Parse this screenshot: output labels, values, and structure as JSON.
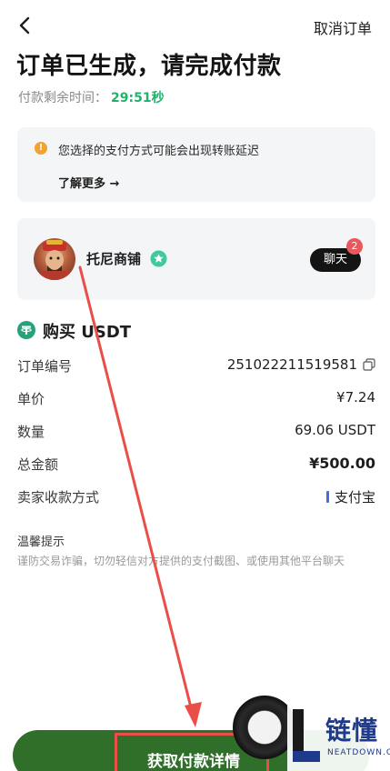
{
  "header": {
    "cancel_label": "取消订单"
  },
  "title": "订单已生成，请完成付款",
  "countdown": {
    "label": "付款剩余时间：",
    "time": "29:51秒"
  },
  "notice": {
    "text": "您选择的支付方式可能会出现转账延迟",
    "more": "了解更多 →"
  },
  "merchant": {
    "name": "托尼商铺",
    "chat_label": "聊天",
    "unread": "2"
  },
  "order": {
    "heading": "购买 USDT",
    "rows": [
      {
        "label": "订单编号",
        "value": "251022211519581"
      },
      {
        "label": "单价",
        "value": "¥7.24"
      },
      {
        "label": "数量",
        "value": "69.06 USDT"
      },
      {
        "label": "总金额",
        "value": "¥500.00"
      },
      {
        "label": "卖家收款方式",
        "value": "支付宝"
      }
    ]
  },
  "tips": {
    "title": "温馨提示",
    "text": "谨防交易诈骗，切勿轻信对方提供的支付截图、或使用其他平台聊天"
  },
  "cta": {
    "label": "获取付款详情"
  },
  "watermark": {
    "name": "链懂",
    "sub": "NEATDOWN.COM"
  },
  "colors": {
    "accent_green": "#20b26b",
    "cta_green": "#2f6f2a",
    "annotation_red": "#e94e48",
    "alipay_blue": "#3f6fdb"
  }
}
